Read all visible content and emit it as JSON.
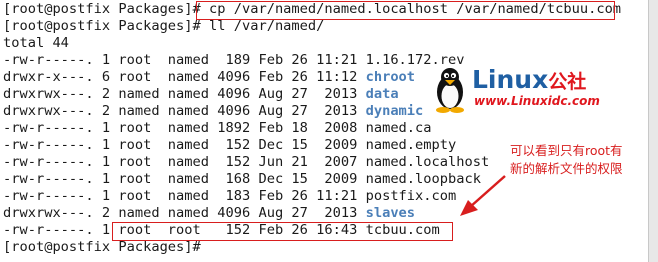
{
  "terminal": {
    "lines": [
      {
        "prompt": "[root@postfix Packages]#",
        "cmd": " cp /var/named/named.localhost /var/named/tcbuu.com"
      },
      {
        "prompt": "[root@postfix Packages]#",
        "cmd": " ll /var/named/"
      },
      {
        "text": "total 44"
      }
    ],
    "files": [
      {
        "prefix": "-rw-r-----. 1 root  named  189 Feb 26 11:21 ",
        "name": "1.16.172.rev",
        "dir": false
      },
      {
        "prefix": "drwxr-x---. 6 root  named 4096 Feb 26 11:12 ",
        "name": "chroot",
        "dir": true
      },
      {
        "prefix": "drwxrwx---. 2 named named 4096 Aug 27  2013 ",
        "name": "data",
        "dir": true
      },
      {
        "prefix": "drwxrwx---. 2 named named 4096 Aug 27  2013 ",
        "name": "dynamic",
        "dir": true
      },
      {
        "prefix": "-rw-r-----. 1 root  named 1892 Feb 18  2008 ",
        "name": "named.ca",
        "dir": false
      },
      {
        "prefix": "-rw-r-----. 1 root  named  152 Dec 15  2009 ",
        "name": "named.empty",
        "dir": false
      },
      {
        "prefix": "-rw-r-----. 1 root  named  152 Jun 21  2007 ",
        "name": "named.localhost",
        "dir": false
      },
      {
        "prefix": "-rw-r-----. 1 root  named  168 Dec 15  2009 ",
        "name": "named.loopback",
        "dir": false
      },
      {
        "prefix": "-rw-r-----. 1 root  named  183 Feb 26 11:21 ",
        "name": "postfix.com",
        "dir": false
      },
      {
        "prefix": "drwxrwx---. 2 named named 4096 Aug 27  2013 ",
        "name": "slaves",
        "dir": true
      },
      {
        "prefix": "-rw-r-----. 1 root  root   152 Feb 26 16:43 ",
        "name": "tcbuu.com",
        "dir": false
      }
    ],
    "final_prompt": "[root@postfix Packages]# "
  },
  "logo": {
    "title": "Linux",
    "title_cn": "公社",
    "url": "www.Linuxidc.com"
  },
  "annotation": {
    "line1": "可以看到只有root有",
    "line2": "新的解析文件的权限"
  },
  "colors": {
    "dir": "#4b7fb8",
    "highlight": "#d81e1e",
    "text": "#1a1a1a"
  },
  "icons": {
    "logo_mascot": "tux-penguin-icon",
    "annotation_arrow": "arrow-icon"
  }
}
